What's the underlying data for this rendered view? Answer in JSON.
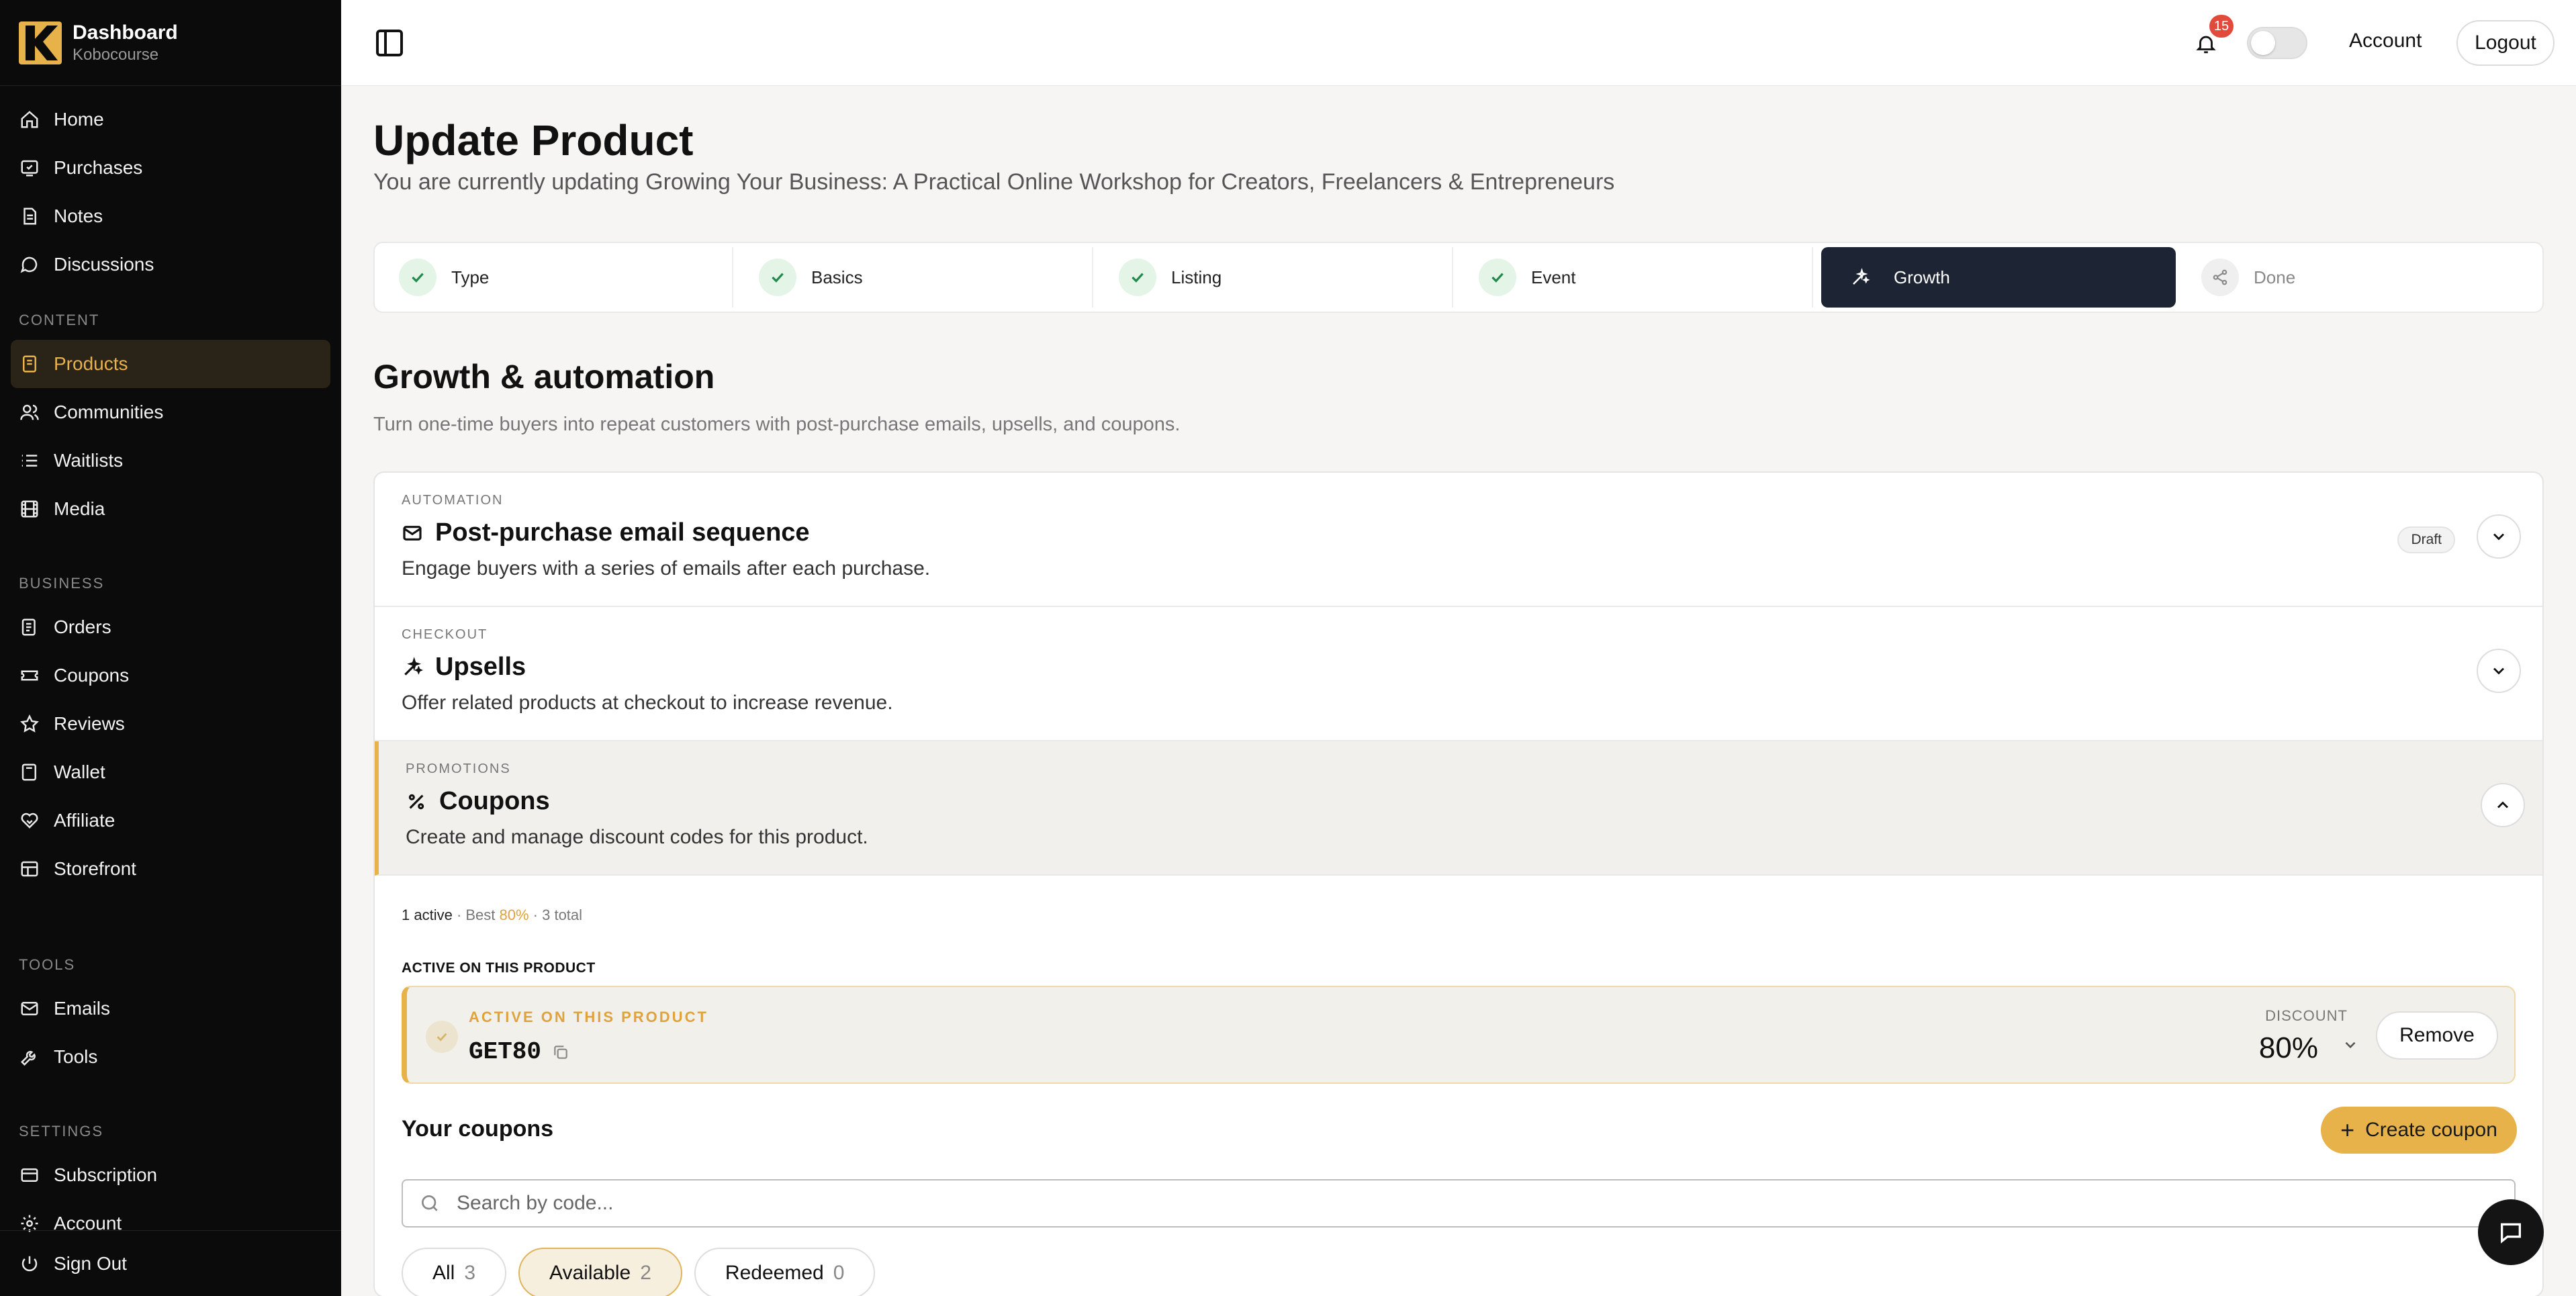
{
  "brand": {
    "title": "Dashboard",
    "subtitle": "Kobocourse"
  },
  "sidebar": {
    "main_items": [
      {
        "label": "Home",
        "icon": "home-icon"
      },
      {
        "label": "Purchases",
        "icon": "purchases-icon"
      },
      {
        "label": "Notes",
        "icon": "notes-icon"
      },
      {
        "label": "Discussions",
        "icon": "chat-bubble-icon"
      }
    ],
    "content_label": "CONTENT",
    "content_items": [
      {
        "label": "Products",
        "icon": "product-icon",
        "active": true
      },
      {
        "label": "Communities",
        "icon": "users-icon"
      },
      {
        "label": "Waitlists",
        "icon": "list-icon"
      },
      {
        "label": "Media",
        "icon": "film-icon"
      }
    ],
    "business_label": "BUSINESS",
    "business_items": [
      {
        "label": "Orders",
        "icon": "orders-icon"
      },
      {
        "label": "Coupons",
        "icon": "ticket-icon"
      },
      {
        "label": "Reviews",
        "icon": "star-icon"
      },
      {
        "label": "Wallet",
        "icon": "wallet-icon"
      },
      {
        "label": "Affiliate",
        "icon": "handshake-icon"
      },
      {
        "label": "Storefront",
        "icon": "storefront-icon"
      }
    ],
    "tools_label": "TOOLS",
    "tools_items": [
      {
        "label": "Emails",
        "icon": "mail-icon"
      },
      {
        "label": "Tools",
        "icon": "wrench-icon"
      }
    ],
    "settings_label": "SETTINGS",
    "settings_items": [
      {
        "label": "Subscription",
        "icon": "card-icon"
      },
      {
        "label": "Account",
        "icon": "gear-icon"
      }
    ],
    "sign_out": "Sign Out"
  },
  "topbar": {
    "notifications_count": "15",
    "account": "Account",
    "logout": "Logout"
  },
  "page": {
    "title": "Update Product",
    "subtitle": "You are currently updating Growing Your Business: A Practical Online Workshop for Creators, Freelancers & Entrepreneurs"
  },
  "steps": [
    {
      "label": "Type",
      "state": "done"
    },
    {
      "label": "Basics",
      "state": "done"
    },
    {
      "label": "Listing",
      "state": "done"
    },
    {
      "label": "Event",
      "state": "done"
    },
    {
      "label": "Growth",
      "state": "current"
    },
    {
      "label": "Done",
      "state": "pending"
    }
  ],
  "section": {
    "title": "Growth & automation",
    "subtitle": "Turn one-time buyers into repeat customers with post-purchase emails, upsells, and coupons."
  },
  "accordions": [
    {
      "kicker": "AUTOMATION",
      "title": "Post-purchase email sequence",
      "desc": "Engage buyers with a series of emails after each purchase.",
      "badge": "Draft"
    },
    {
      "kicker": "CHECKOUT",
      "title": "Upsells",
      "desc": "Offer related products at checkout to increase revenue."
    },
    {
      "kicker": "PROMOTIONS",
      "title": "Coupons",
      "desc": "Create and manage discount codes for this product."
    }
  ],
  "coupons": {
    "stats_active": "1 active",
    "stats_sep1": " · Best ",
    "stats_best": "80%",
    "stats_total": " · 3 total",
    "active_section_label": "ACTIVE ON THIS PRODUCT",
    "active_card_label": "ACTIVE ON THIS PRODUCT",
    "active_code": "GET80",
    "discount_label": "DISCOUNT",
    "discount_value": "80%",
    "remove": "Remove",
    "your_coupons": "Your coupons",
    "create": "Create coupon",
    "search_placeholder": "Search by code...",
    "filters": [
      {
        "label": "All",
        "count": "3"
      },
      {
        "label": "Available",
        "count": "2",
        "selected": true
      },
      {
        "label": "Redeemed",
        "count": "0"
      }
    ]
  },
  "colors": {
    "accent": "#e7b24a",
    "sidebar_bg": "#0b0b0b",
    "step_active": "#1d2433"
  }
}
